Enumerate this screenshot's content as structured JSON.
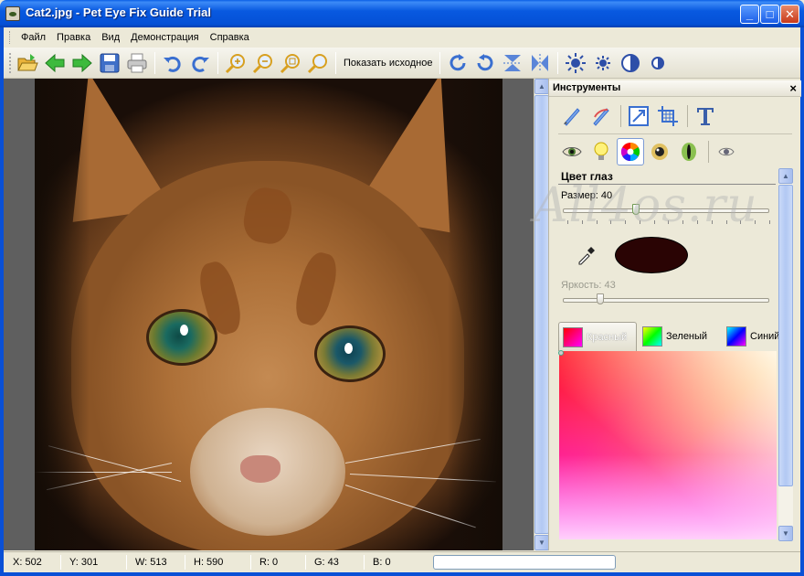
{
  "window": {
    "title": "Cat2.jpg - Pet Eye Fix Guide Trial",
    "minimize_label": "_",
    "maximize_label": "□",
    "close_label": "✕"
  },
  "menu": {
    "items": [
      {
        "label": "Файл"
      },
      {
        "label": "Правка"
      },
      {
        "label": "Вид"
      },
      {
        "label": "Демонстрация"
      },
      {
        "label": "Справка"
      }
    ]
  },
  "toolbar": {
    "show_original_label": "Показать исходное",
    "icons": [
      "open-icon",
      "back-icon",
      "forward-icon",
      "save-icon",
      "print-icon",
      "undo-icon",
      "redo-icon",
      "zoom-in-icon",
      "zoom-out-icon",
      "zoom-fit-icon",
      "zoom-actual-icon",
      "rotate-cw-icon",
      "rotate-ccw-icon",
      "flip-vertical-icon",
      "flip-horizontal-icon",
      "brightness-up-icon",
      "brightness-down-icon",
      "contrast-up-icon",
      "contrast-down-icon"
    ]
  },
  "tools_panel": {
    "title": "Инструменты",
    "close_label": "×",
    "section_title": "Цвет глаз",
    "size_label": "Размер: 40",
    "size_value": 40,
    "brightness_label": "Яркость: 43",
    "brightness_value": 43,
    "eye_color": "#2A0404",
    "color_tabs": [
      {
        "label": "Красный",
        "active": true
      },
      {
        "label": "Зеленый",
        "active": false
      },
      {
        "label": "Синий",
        "active": false
      }
    ]
  },
  "watermark": "All4os.ru",
  "statusbar": {
    "x": "X: 502",
    "y": "Y: 301",
    "w": "W: 513",
    "h": "H: 590",
    "r": "R: 0",
    "g": "G: 43",
    "b": "B: 0"
  }
}
